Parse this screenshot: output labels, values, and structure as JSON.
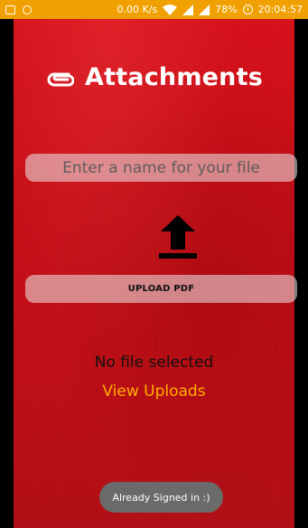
{
  "status_bar": {
    "network_speed": "0.00 K/s",
    "battery": "78%",
    "time": "20:04:57",
    "icons": [
      "image-icon",
      "circle-icon",
      "wifi-icon",
      "signal-icon",
      "signal-icon-2",
      "alarm-icon"
    ]
  },
  "header": {
    "title": "Attachments",
    "icon": "paperclip-icon"
  },
  "file_name_input": {
    "placeholder": "Enter a name for your file",
    "value": ""
  },
  "upload": {
    "icon": "upload-icon",
    "button_label": "UPLOAD PDF"
  },
  "file_status": {
    "text": "No file selected"
  },
  "link": {
    "view_uploads": "View Uploads"
  },
  "toast": {
    "message": "Already Signed in :)"
  },
  "colors": {
    "background": "#c70f18",
    "status_bar": "#f0a000",
    "link": "#ffb000",
    "input_bg": "#d9d9d9"
  }
}
